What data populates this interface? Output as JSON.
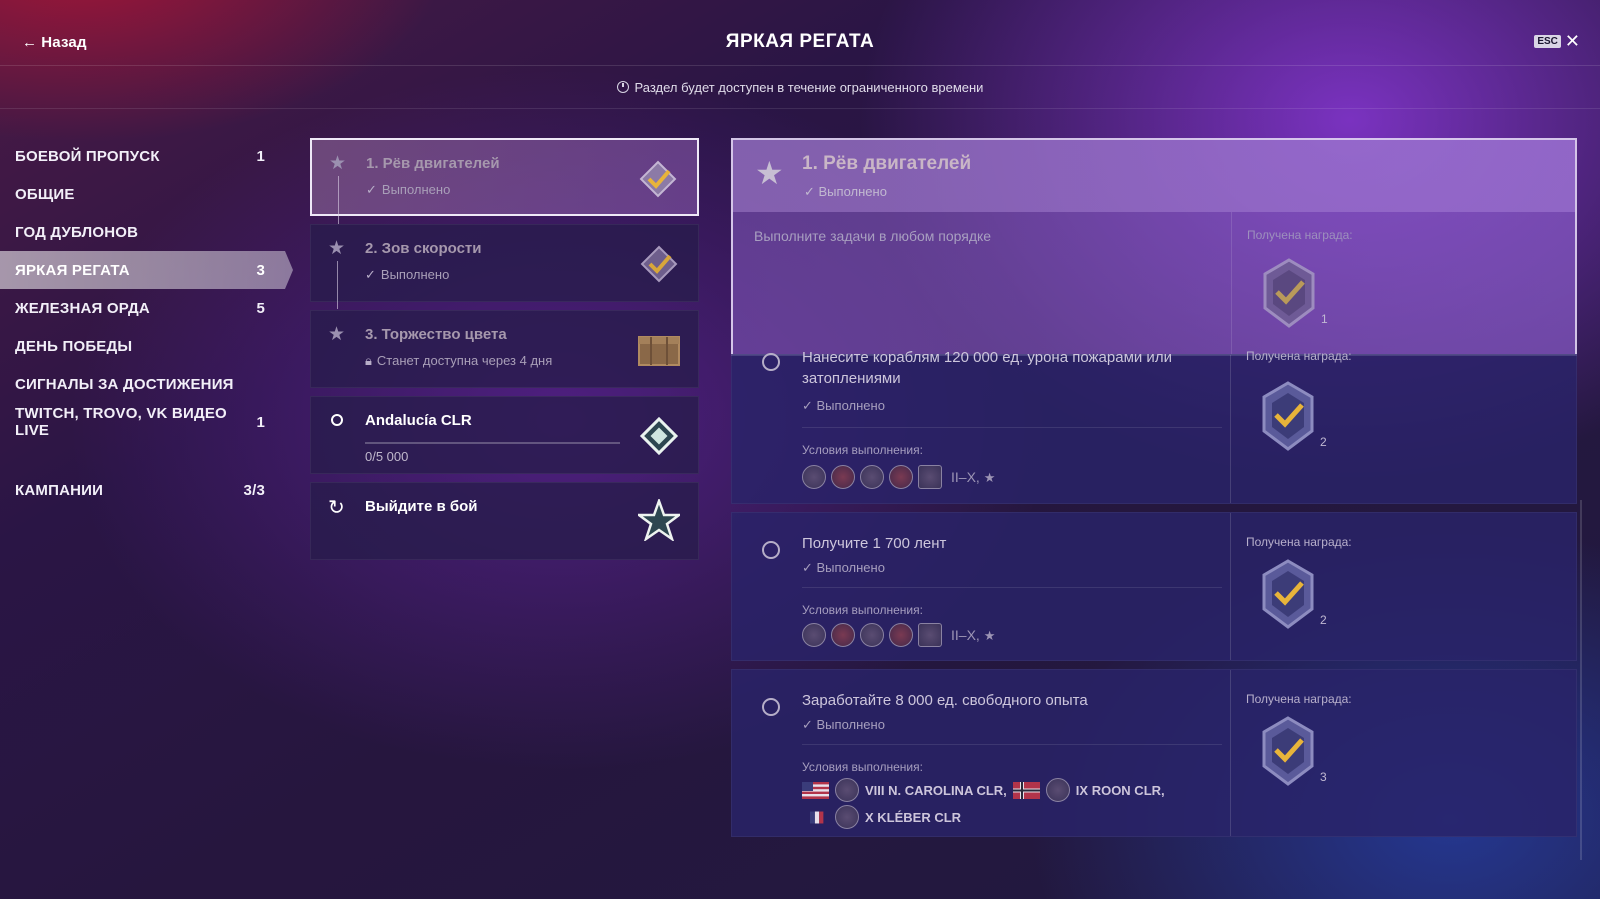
{
  "header": {
    "back_label": "Назад",
    "title": "ЯРКАЯ РЕГАТА",
    "esc_label": "ESC",
    "notice": "Раздел будет доступен в течение ограниченного времени"
  },
  "sidebar": {
    "items": [
      {
        "label": "БОЕВОЙ ПРОПУСК",
        "badge": "1"
      },
      {
        "label": "ОБЩИЕ",
        "badge": ""
      },
      {
        "label": "ГОД ДУБЛОНОВ",
        "badge": ""
      },
      {
        "label": "ЯРКАЯ РЕГАТА",
        "badge": "3"
      },
      {
        "label": "ЖЕЛЕЗНАЯ ОРДА",
        "badge": "5"
      },
      {
        "label": "ДЕНЬ ПОБЕДЫ",
        "badge": ""
      },
      {
        "label": "СИГНАЛЫ ЗА ДОСТИЖЕНИЯ",
        "badge": ""
      },
      {
        "label": "TWITCH, TROVO, VK ВИДЕО LIVE",
        "badge": "1"
      },
      {
        "label": "КАМПАНИИ",
        "badge": "3/3"
      }
    ],
    "active_index": 3
  },
  "tasks": [
    {
      "name": "1. Рёв двигателей",
      "status": "Выполнено",
      "icon": "completed-diamond-icon"
    },
    {
      "name": "2. Зов скорости",
      "status": "Выполнено",
      "icon": "completed-diamond-icon"
    },
    {
      "name": "3. Торжество цвета",
      "status": "Станет доступна через 4 дня",
      "icon": "crate-icon"
    },
    {
      "name": "Andalucía CLR",
      "progress_text": "0/5 000",
      "progress": 0,
      "icon": "diamond-icon"
    },
    {
      "name": "Выйдите в бой",
      "icon": "star-icon"
    }
  ],
  "detail": {
    "title": "1. Рёв двигателей",
    "status": "Выполнено",
    "description": "Выполните задачи в любом порядке",
    "reward_label": "Получена награда:",
    "reward_count": "1",
    "subtasks": [
      {
        "title": "Нанесите кораблям 120 000 ед. урона пожарами или затоплениями",
        "status": "Выполнено",
        "conditions_label": "Условия выполнения:",
        "tier": "II–X,",
        "reward_label": "Получена награда:",
        "reward_count": "2"
      },
      {
        "title": "Получите 1 700 лент",
        "status": "Выполнено",
        "conditions_label": "Условия выполнения:",
        "tier": "II–X,",
        "reward_label": "Получена награда:",
        "reward_count": "2"
      },
      {
        "title": "Заработайте 8 000 ед. свободного опыта",
        "status": "Выполнено",
        "conditions_label": "Условия выполнения:",
        "ships": [
          "VIII N. CAROLINA CLR,",
          "IX ROON CLR,",
          "X KLÉBER CLR"
        ],
        "reward_label": "Получена награда:",
        "reward_count": "3"
      }
    ]
  },
  "colors": {
    "accent_gold": "#e8b43a",
    "active_tab": "#d8d0e6"
  }
}
